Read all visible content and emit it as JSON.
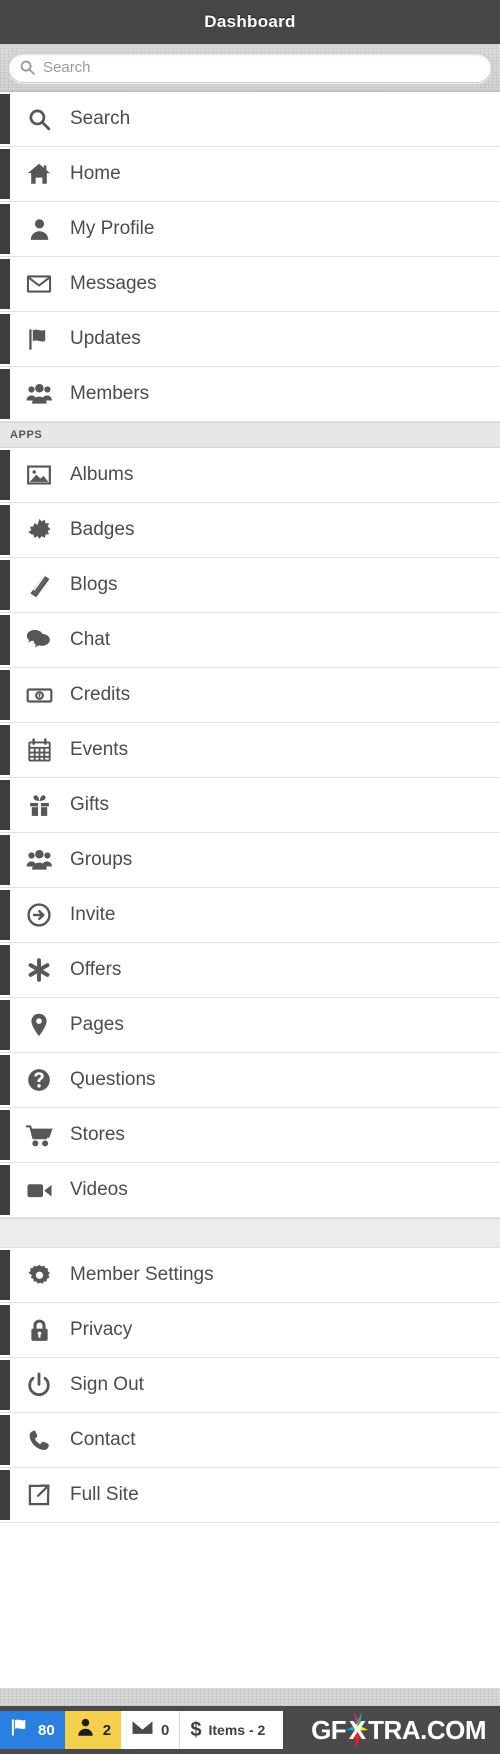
{
  "header": {
    "title": "Dashboard"
  },
  "search": {
    "placeholder": "Search",
    "value": "",
    "icon": "search-icon"
  },
  "menu": {
    "primary": [
      {
        "label": "Search",
        "icon": "search-icon"
      },
      {
        "label": "Home",
        "icon": "home-icon"
      },
      {
        "label": "My Profile",
        "icon": "person-icon"
      },
      {
        "label": "Messages",
        "icon": "envelope-icon"
      },
      {
        "label": "Updates",
        "icon": "flag-icon"
      },
      {
        "label": "Members",
        "icon": "people-icon"
      }
    ],
    "apps_section_title": "APPS",
    "apps": [
      {
        "label": "Albums",
        "icon": "image-icon"
      },
      {
        "label": "Badges",
        "icon": "badge-starburst-icon"
      },
      {
        "label": "Blogs",
        "icon": "book-icon"
      },
      {
        "label": "Chat",
        "icon": "chat-bubbles-icon"
      },
      {
        "label": "Credits",
        "icon": "banknote-icon"
      },
      {
        "label": "Events",
        "icon": "calendar-icon"
      },
      {
        "label": "Gifts",
        "icon": "gift-icon"
      },
      {
        "label": "Groups",
        "icon": "people-icon"
      },
      {
        "label": "Invite",
        "icon": "arrow-circle-right-icon"
      },
      {
        "label": "Offers",
        "icon": "asterisk-icon"
      },
      {
        "label": "Pages",
        "icon": "map-pin-icon"
      },
      {
        "label": "Questions",
        "icon": "question-circle-icon"
      },
      {
        "label": "Stores",
        "icon": "shopping-cart-icon"
      },
      {
        "label": "Videos",
        "icon": "video-camera-icon"
      }
    ],
    "settings": [
      {
        "label": "Member Settings",
        "icon": "gear-icon"
      },
      {
        "label": "Privacy",
        "icon": "lock-icon"
      },
      {
        "label": "Sign Out",
        "icon": "power-icon"
      },
      {
        "label": "Contact",
        "icon": "phone-icon"
      },
      {
        "label": "Full Site",
        "icon": "external-link-icon"
      }
    ]
  },
  "statusbar": {
    "pills": [
      {
        "name": "updates",
        "icon": "flag-icon",
        "count": "80",
        "bg": "#2a7fe0"
      },
      {
        "name": "friends",
        "icon": "person-icon",
        "count": "2",
        "bg": "#f5d04e"
      },
      {
        "name": "messages",
        "icon": "envelope-icon",
        "count": "0",
        "bg": "#ffffff"
      },
      {
        "name": "cart",
        "icon": "dollar-icon",
        "count": "Items - 2",
        "bg": "#ffffff"
      }
    ]
  },
  "watermark": {
    "pre": "GF",
    "x": "X",
    "post": "TRA.COM"
  },
  "colors": {
    "header_bg": "#464646",
    "row_bg": "#ffffff",
    "accent_strip": "#3d3d3d",
    "text": "#4c4c4c",
    "section_bg": "#e7e7e7",
    "statusbar_bg": "#4a4a4a",
    "badge_blue": "#2a7fe0",
    "badge_yellow": "#f5d04e"
  }
}
